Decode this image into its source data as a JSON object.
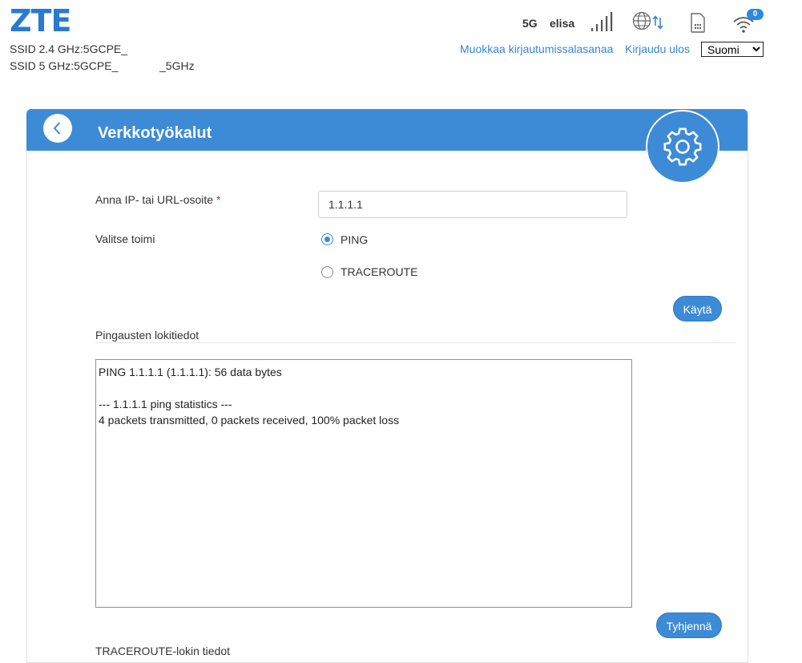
{
  "header": {
    "logo": "ZTE",
    "ssid_24": "SSID 2.4 GHz:5GCPE_",
    "ssid_5_prefix": "SSID 5 GHz:5GCPE_",
    "ssid_5_suffix": "_5GHz",
    "network_type": "5G",
    "operator": "elisa",
    "wifi_clients": "0",
    "change_password_link": "Muokkaa kirjautumissalasanaa",
    "logout_link": "Kirjaudu ulos",
    "language_selected": "Suomi",
    "icons": [
      "signal-bars-icon",
      "internet-globe-icon",
      "sim-card-icon",
      "wifi-icon"
    ]
  },
  "panel": {
    "title": "Verkkotyökalut",
    "back_icon": "chevron-left-icon",
    "section_icon": "gear-icon",
    "form": {
      "address_label": "Anna IP- tai URL-osoite",
      "required_mark": "*",
      "address_value": "1.1.1.1",
      "action_label": "Valitse toimi",
      "options": [
        {
          "label": "PING",
          "selected": true
        },
        {
          "label": "TRACEROUTE",
          "selected": false
        }
      ],
      "run_button": "Käytä"
    },
    "ping_log": {
      "title": "Pingausten lokitiedot",
      "content": "PING 1.1.1.1 (1.1.1.1): 56 data bytes\n\n--- 1.1.1.1 ping statistics ---\n4 packets transmitted, 0 packets received, 100% packet loss",
      "clear_button": "Tyhjennä"
    },
    "traceroute_log": {
      "title": "TRACEROUTE-lokin tiedot"
    }
  },
  "colors": {
    "accent": "#3d8bd6",
    "link": "#3a86d0",
    "logo": "#2a7ad2",
    "required": "#d9262f"
  }
}
